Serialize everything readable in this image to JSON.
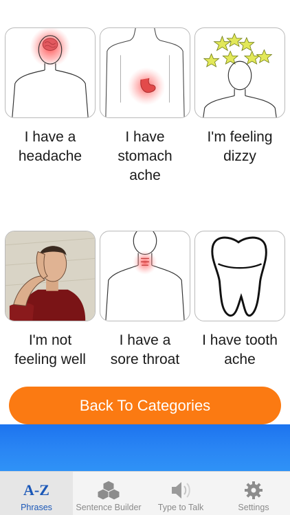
{
  "phrases": [
    {
      "label": "I have a headache",
      "lines": [
        "I have a",
        "headache"
      ],
      "icon": "headache-icon"
    },
    {
      "label": "I have stomach ache",
      "lines": [
        "I have",
        "stomach",
        "ache"
      ],
      "icon": "stomach-ache-icon"
    },
    {
      "label": "I'm feeling dizzy",
      "lines": [
        "I'm feeling",
        "dizzy"
      ],
      "icon": "dizzy-icon"
    },
    {
      "label": "I'm not feeling well",
      "lines": [
        "I'm not",
        "feeling well"
      ],
      "icon": "unwell-man-icon"
    },
    {
      "label": "I have a sore throat",
      "lines": [
        "I have a",
        "sore throat"
      ],
      "icon": "sore-throat-icon"
    },
    {
      "label": "I have tooth ache",
      "lines": [
        "I have tooth",
        "ache"
      ],
      "icon": "tooth-icon"
    }
  ],
  "back_button": {
    "label": "Back To Categories"
  },
  "tabbar": {
    "tabs": [
      {
        "label": "Phrases",
        "icon": "a-z-icon",
        "glyph": "A-Z",
        "active": true
      },
      {
        "label": "Sentence Builder",
        "icon": "cubes-icon",
        "active": false
      },
      {
        "label": "Type to Talk",
        "icon": "speaker-icon",
        "active": false
      },
      {
        "label": "Settings",
        "icon": "gear-icon",
        "active": false
      }
    ]
  },
  "colors": {
    "accent_orange": "#fb7a12",
    "banner_blue": "#2a86f4",
    "active_tab_text": "#1a57b7"
  }
}
